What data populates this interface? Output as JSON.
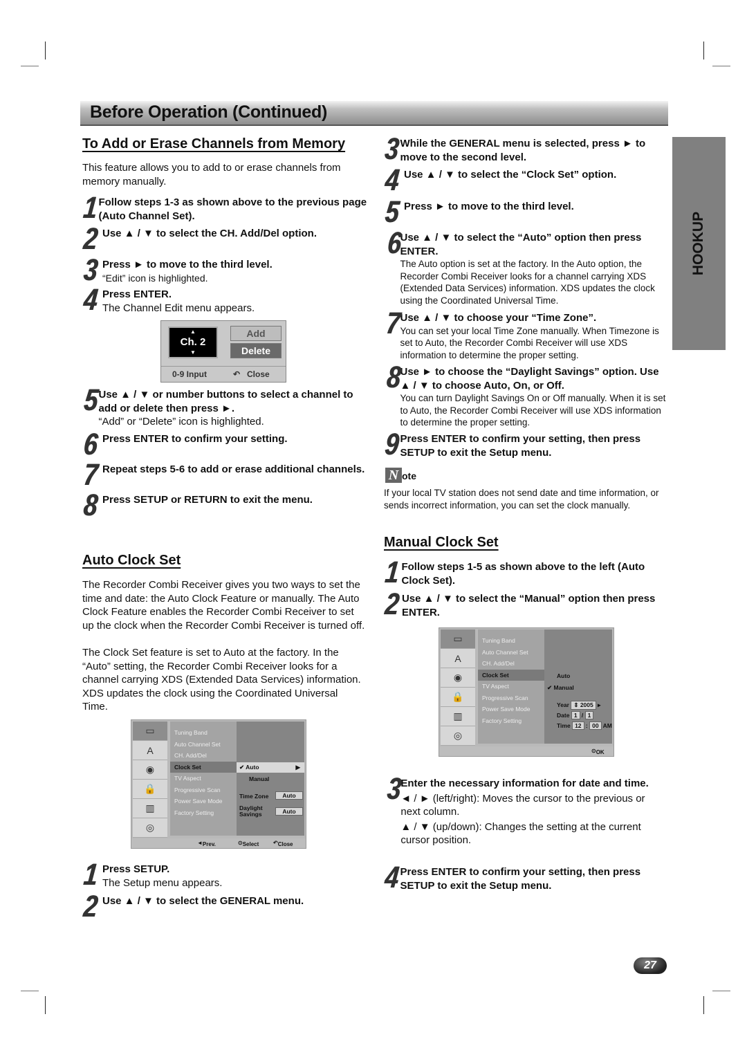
{
  "banner_title": "Before Operation (Continued)",
  "sidebar_tab": "HOOKUP",
  "page_number": "27",
  "add_erase": {
    "heading": "To Add or Erase Channels from Memory",
    "intro": "This feature allows you to add to or erase channels from memory manually.",
    "steps": [
      {
        "n": "1",
        "bold": "Follow steps 1-3 as shown above to the previous page (Auto Channel Set).",
        "sub": ""
      },
      {
        "n": "2",
        "bold": "Use ▲ / ▼ to select the CH. Add/Del option.",
        "sub": ""
      },
      {
        "n": "3",
        "bold": "Press ► to move to the third level.",
        "sub": "“Edit” icon is highlighted."
      },
      {
        "n": "4",
        "bold": "Press ENTER.",
        "sub": "The Channel Edit menu appears."
      },
      {
        "n": "5",
        "bold": "Use ▲ / ▼ or number buttons to select a channel to add or delete then press ►.",
        "sub": "“Add” or “Delete” icon is highlighted."
      },
      {
        "n": "6",
        "bold": "Press ENTER to confirm your setting.",
        "sub": ""
      },
      {
        "n": "7",
        "bold": "Repeat steps 5-6 to add or erase additional channels.",
        "sub": ""
      },
      {
        "n": "8",
        "bold": "Press SETUP or RETURN to exit the menu.",
        "sub": ""
      }
    ],
    "channel_edit": {
      "channel": "Ch. 2",
      "add": "Add",
      "delete": "Delete",
      "input_hint": "0-9 Input",
      "close": "Close"
    }
  },
  "auto_clock": {
    "heading": "Auto Clock Set",
    "body1": "The Recorder Combi Receiver gives you two ways to set the time and date: the Auto Clock Feature or manually. The Auto Clock Feature enables the Recorder Combi Receiver to set up the clock when the Recorder Combi Receiver is turned off.",
    "body2": "The Clock Set feature is set to Auto at the factory. In the “Auto” setting, the Recorder Combi Receiver looks for a channel carrying XDS (Extended Data Services) information. XDS updates the clock using the Coordinated Universal Time.",
    "steps": [
      {
        "n": "1",
        "bold": "Press SETUP.",
        "sub": "The Setup menu appears."
      },
      {
        "n": "2",
        "bold": "Use ▲ / ▼ to select the GENERAL menu.",
        "sub": ""
      },
      {
        "n": "3",
        "bold": "While the GENERAL menu is selected, press ► to move to the second level.",
        "sub": ""
      },
      {
        "n": "4",
        "bold": "Use ▲ / ▼ to select the “Clock Set” option.",
        "sub": ""
      },
      {
        "n": "5",
        "bold": "Press ► to move to the third level.",
        "sub": ""
      },
      {
        "n": "6",
        "bold": "Use ▲ / ▼ to select the “Auto” option then press ENTER.",
        "sub": "The Auto option is set at the factory. In the Auto option, the Recorder Combi Receiver looks for a channel carrying XDS (Extended Data Services) information. XDS updates the clock using the Coordinated Universal Time."
      },
      {
        "n": "7",
        "bold": "Use ▲ / ▼ to choose your “Time Zone”.",
        "sub": "You can set your local Time Zone manually. When Timezone is set to Auto, the Recorder Combi Receiver will use XDS information to determine the proper setting."
      },
      {
        "n": "8",
        "bold": "Use ► to choose the “Daylight Savings” option. Use ▲ / ▼ to choose Auto, On, or Off.",
        "sub": "You can turn Daylight Savings On or Off manually. When it is set to Auto, the Recorder Combi Receiver will use XDS information to determine the proper setting."
      },
      {
        "n": "9",
        "bold": "Press ENTER to confirm your setting, then press SETUP to exit the Setup menu.",
        "sub": ""
      }
    ],
    "menu": {
      "options": [
        "Tuning Band",
        "Auto Channel Set",
        "CH. Add/Del",
        "Clock Set",
        "TV Aspect",
        "Progressive Scan",
        "Power Save Mode",
        "Factory Setting"
      ],
      "selected": "Clock Set",
      "choice_auto": "Auto",
      "choice_manual": "Manual",
      "time_zone_label": "Time Zone",
      "time_zone_value": "Auto",
      "daylight_label": "Daylight Savings",
      "daylight_value": "Auto",
      "footer_prev": "Prev.",
      "footer_select": "Select",
      "footer_close": "Close"
    }
  },
  "note": {
    "label": "ote",
    "text": "If your local TV station does not send date and time information, or sends incorrect information, you can set the clock manually."
  },
  "manual_clock": {
    "heading": "Manual Clock Set",
    "steps": [
      {
        "n": "1",
        "bold": "Follow steps 1-5 as shown above to the left (Auto Clock Set).",
        "sub": ""
      },
      {
        "n": "2",
        "bold": "Use ▲ / ▼ to select the “Manual” option then press ENTER.",
        "sub": ""
      },
      {
        "n": "3",
        "bold": "Enter the necessary information for date and time.",
        "sub": "◄ / ► (left/right): Moves the cursor to the previous or next column.",
        "sub2": "▲ / ▼ (up/down): Changes the setting at the current cursor position."
      },
      {
        "n": "4",
        "bold": "Press ENTER to confirm your setting, then press SETUP to exit the Setup menu.",
        "sub": ""
      }
    ],
    "menu": {
      "options": [
        "Tuning Band",
        "Auto Channel Set",
        "CH. Add/Del",
        "Clock Set",
        "TV Aspect",
        "Progressive Scan",
        "Power Save Mode",
        "Factory Setting"
      ],
      "selected": "Clock Set",
      "choice_auto": "Auto",
      "choice_manual": "Manual",
      "year_label": "Year",
      "year_value": "2005",
      "date_label": "Date",
      "date_month": "1",
      "date_day": "1",
      "time_label": "Time",
      "time_hour": "12",
      "time_min": "00",
      "time_ampm": "AM",
      "footer_ok": "OK"
    }
  }
}
